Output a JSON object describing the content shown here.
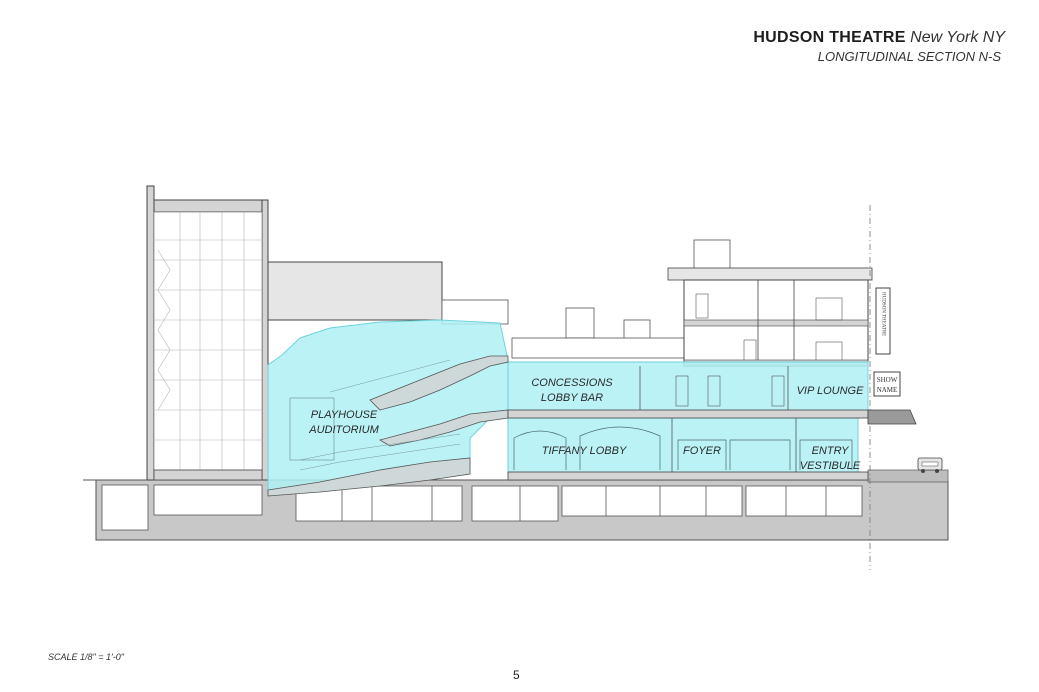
{
  "header": {
    "title": "HUDSON THEATRE",
    "location": "New York NY",
    "subtitle": "LONGITUDINAL SECTION N-S"
  },
  "rooms": {
    "playhouse_line1": "PLAYHOUSE",
    "playhouse_line2": "AUDITORIUM",
    "concessions_line1": "CONCESSIONS",
    "concessions_line2": "LOBBY BAR",
    "vip_lounge": "VIP LOUNGE",
    "tiffany_lobby": "TIFFANY LOBBY",
    "foyer": "FOYER",
    "entry_line1": "ENTRY",
    "entry_line2": "VESTIBULE"
  },
  "signage": {
    "blade_sign": "HUDSON THEATRE",
    "marquee_line1": "SHOW",
    "marquee_line2": "NAME"
  },
  "footer": {
    "scale": "SCALE 1/8\" = 1'-0\"",
    "page_number": "5"
  },
  "colors": {
    "highlight": "#aef0f4",
    "highlight_stroke": "#6fd3db",
    "wall_gray": "#d4d4d4",
    "ground_gray": "#bdbdbd",
    "line": "#444444"
  }
}
